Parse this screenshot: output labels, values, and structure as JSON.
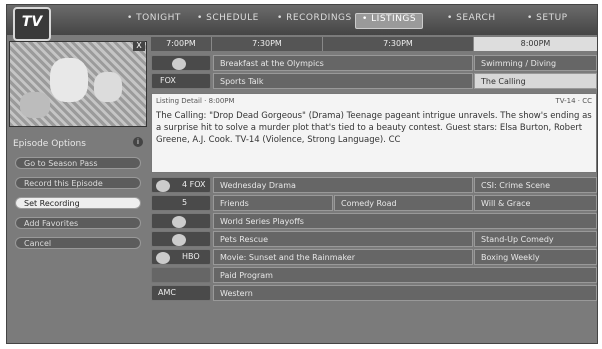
{
  "logo": {
    "text": "TV"
  },
  "nav": {
    "items": [
      {
        "label": "• TONIGHT"
      },
      {
        "label": "• SCHEDULE"
      },
      {
        "label": "• RECORDINGS"
      },
      {
        "label": "• LISTINGS"
      },
      {
        "label": "• SEARCH"
      },
      {
        "label": "• SETUP"
      }
    ]
  },
  "preview": {
    "close": "X"
  },
  "options": {
    "title": "Episode Options",
    "info": "i",
    "buttons": [
      {
        "label": "Go to Season Pass"
      },
      {
        "label": "Record this Episode"
      },
      {
        "label": "Set Recording"
      },
      {
        "label": "Add Favorites"
      },
      {
        "label": "Cancel"
      }
    ]
  },
  "times": [
    {
      "label": "7:00PM"
    },
    {
      "label": "7:30PM"
    },
    {
      "label": "7:30PM"
    },
    {
      "label": "8:00PM"
    }
  ],
  "top_rows": [
    {
      "num": "",
      "programs": [
        {
          "title": "Breakfast at the Olympics"
        },
        {
          "title": "Swimming / Diving"
        }
      ]
    },
    {
      "num": "FOX",
      "programs": [
        {
          "title": "Sports Talk"
        },
        {
          "title": "The Calling"
        }
      ]
    }
  ],
  "description": {
    "header": "Listing Detail · 8:00PM",
    "rating": "TV-14 · CC",
    "text": "The Calling: \"Drop Dead Gorgeous\" (Drama) Teenage pageant intrigue unravels. The show's ending as a surprise hit to solve a murder plot that's tied to a beauty contest. Guest stars: Elsa Burton, Robert Greene, A.J. Cook. TV-14 (Violence, Strong Language). CC"
  },
  "bottom_rows": [
    {
      "num": "4 FOX",
      "programs": [
        {
          "title": "Wednesday Drama"
        },
        {
          "title": "CSI: Crime Scene"
        }
      ]
    },
    {
      "num": "5",
      "programs": [
        {
          "title": "Friends"
        },
        {
          "title": "Comedy Road"
        },
        {
          "title": "Will & Grace"
        }
      ]
    },
    {
      "num": "",
      "programs": [
        {
          "title": "World Series Playoffs"
        }
      ]
    },
    {
      "num": "",
      "programs": [
        {
          "title": "Pets Rescue"
        },
        {
          "title": "Stand-Up Comedy"
        }
      ]
    },
    {
      "num": "HBO",
      "programs": [
        {
          "title": "Movie: Sunset and the Rainmaker"
        },
        {
          "title": "Boxing Weekly"
        }
      ]
    },
    {
      "num": "",
      "programs": [
        {
          "title": "Paid Program"
        }
      ]
    },
    {
      "num": "AMC",
      "programs": [
        {
          "title": "Western"
        }
      ]
    }
  ]
}
